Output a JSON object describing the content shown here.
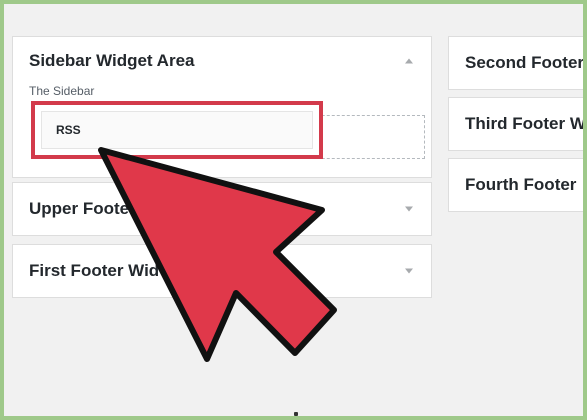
{
  "sidebar_area": {
    "title": "Sidebar Widget Area",
    "description": "The Sidebar",
    "widget_label": "RSS",
    "state": "expanded"
  },
  "collapsed_areas": {
    "upper_footer": "Upper Footer",
    "first_footer": "First Footer Wid",
    "second_footer": "Second Footer",
    "third_footer": "Third Footer W",
    "fourth_footer": "Fourth Footer"
  },
  "colors": {
    "highlight": "#d33a4b",
    "arrow": "#e0384a",
    "background_frame": "#9fc98a",
    "panel_bg": "#ffffff",
    "page_bg": "#f1f1f1"
  },
  "icons": {
    "collapse": "chevron-up-icon",
    "expand": "chevron-down-icon",
    "pointer": "red-arrow-pointer"
  }
}
